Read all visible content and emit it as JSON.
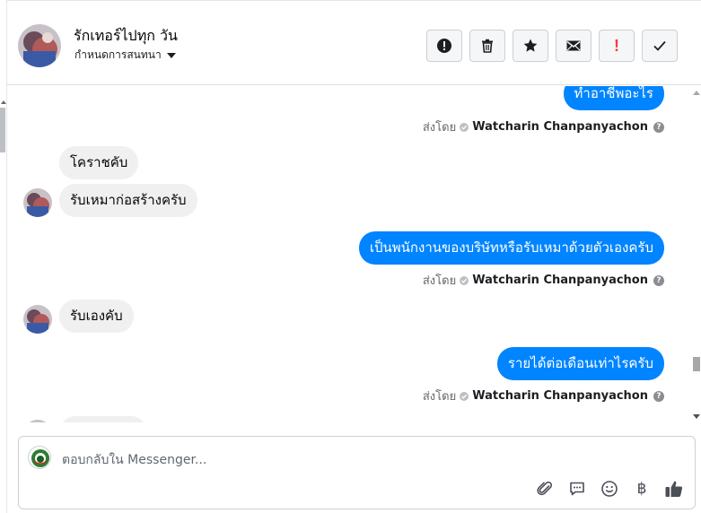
{
  "header": {
    "title": "รักเทอร์ไปทุก วัน",
    "subtitle": "กำหนดการสนทนา"
  },
  "messages": [
    {
      "direction": "out",
      "text": "ทำอาชีพอะไร"
    },
    {
      "direction": "in",
      "text": "โคราชคับ"
    },
    {
      "direction": "in",
      "text": "รับเหมาก่อสร้างครับ"
    },
    {
      "direction": "out",
      "text": "เป็นพนักงานของบริษัทหรือรับเหมาด้วยตัวเองครับ"
    },
    {
      "direction": "in",
      "text": "รับเองคับ"
    },
    {
      "direction": "out",
      "text": "รายได้ต่อเดือนเท่าไรครับ"
    }
  ],
  "sent_by": {
    "prefix": "ส่งโดย",
    "name": "Watcharin Chanpanyachon"
  },
  "composer": {
    "placeholder": "ตอบกลับใน Messenger..."
  },
  "colors": {
    "outgoing_bubble": "#0084ff",
    "incoming_bubble": "#f0f0f0",
    "alert_red": "#fa383e"
  }
}
